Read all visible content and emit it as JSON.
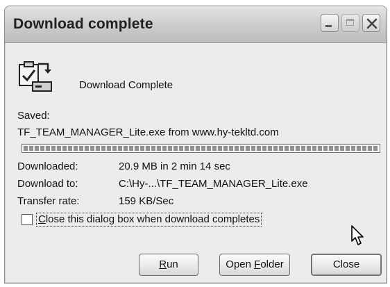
{
  "window": {
    "title": "Download complete",
    "controls": {
      "minimize_icon": "minimize-icon",
      "maximize_icon": "maximize-icon",
      "close_icon": "close-icon"
    }
  },
  "header": {
    "icon": "download-complete-icon",
    "text": "Download Complete"
  },
  "saved": {
    "label": "Saved:",
    "file": "TF_TEAM_MANAGER_Lite.exe from www.hy-tekltd.com"
  },
  "progress": {
    "percent": 100
  },
  "details": [
    {
      "key": "Downloaded:",
      "value": "20.9 MB in 2 min 14 sec"
    },
    {
      "key": "Download to:",
      "value": "C:\\Hy-...\\TF_TEAM_MANAGER_Lite.exe"
    },
    {
      "key": "Transfer rate:",
      "value": "159 KB/Sec"
    }
  ],
  "option": {
    "checked": false,
    "label_first_char": "C",
    "label_rest": "lose this dialog box when download completes"
  },
  "buttons": {
    "run": {
      "accel": "R",
      "rest": "un"
    },
    "open_folder": {
      "before": "Open ",
      "accel": "F",
      "rest": "older"
    },
    "close": "Close"
  },
  "cursor_icon": "mouse-pointer-icon"
}
